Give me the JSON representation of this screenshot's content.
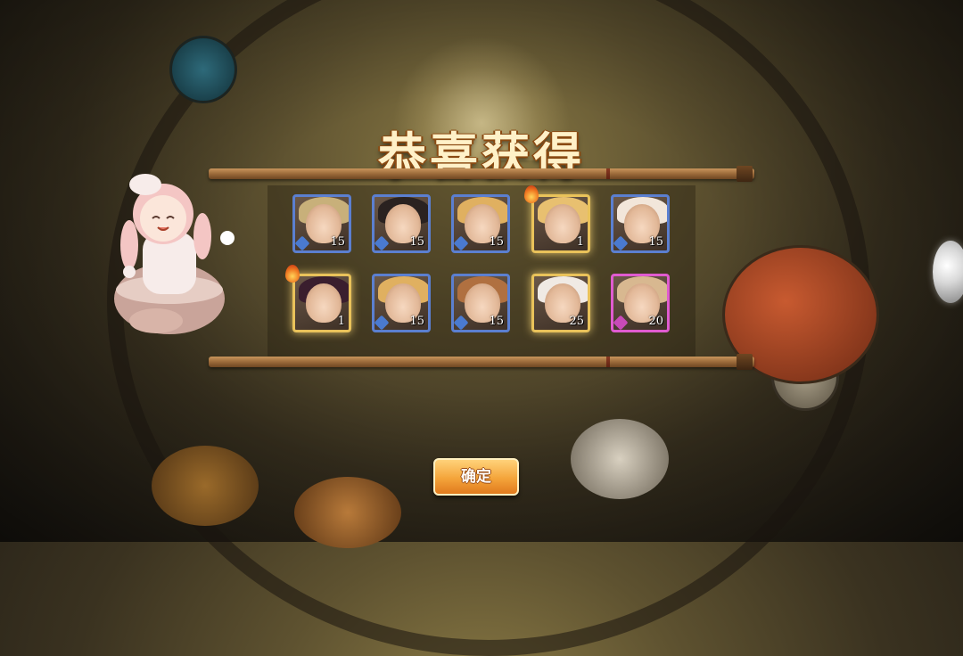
{
  "title": "恭喜获得",
  "confirm_label": "确定",
  "rewards_row1": [
    {
      "count": "15",
      "frame": "blue",
      "hair": "#c8b07a",
      "fire": false
    },
    {
      "count": "15",
      "frame": "blue",
      "hair": "#2a2220",
      "fire": false
    },
    {
      "count": "15",
      "frame": "blue",
      "hair": "#e0b060",
      "fire": false
    },
    {
      "count": "1",
      "frame": "gold",
      "hair": "#e8c070",
      "fire": true
    },
    {
      "count": "15",
      "frame": "blue",
      "hair": "#f2e6da",
      "fire": false
    }
  ],
  "rewards_row2": [
    {
      "count": "1",
      "frame": "gold",
      "hair": "#3a1e2e",
      "fire": true
    },
    {
      "count": "15",
      "frame": "blue",
      "hair": "#e0b060",
      "fire": false
    },
    {
      "count": "15",
      "frame": "blue",
      "hair": "#b07040",
      "fire": false
    },
    {
      "count": "25",
      "frame": "gold",
      "hair": "#f0eae4",
      "fire": false
    },
    {
      "count": "20",
      "frame": "pink",
      "hair": "#d8b890",
      "fire": false
    }
  ]
}
